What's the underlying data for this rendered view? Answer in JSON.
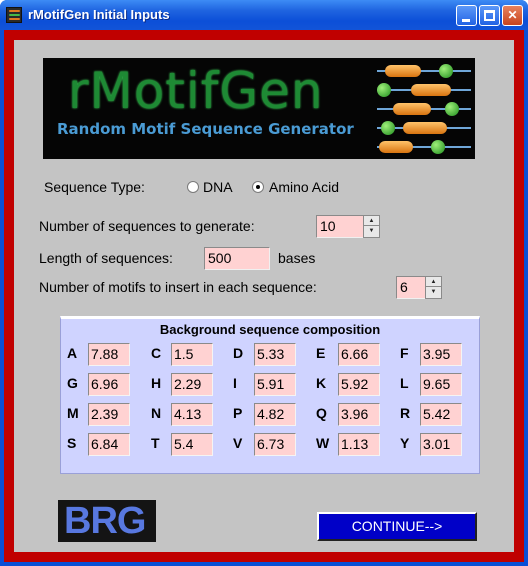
{
  "window": {
    "title": "rMotifGen Initial Inputs"
  },
  "banner": {
    "title": "rMotifGen",
    "subtitle": "Random Motif Sequence Generator"
  },
  "sequence_type": {
    "label": "Sequence Type:",
    "options": [
      "DNA",
      "Amino Acid"
    ],
    "selected": "Amino Acid"
  },
  "num_sequences": {
    "label": "Number of sequences to generate:",
    "value": "10"
  },
  "length": {
    "label": "Length of sequences:",
    "value": "500",
    "unit": "bases"
  },
  "num_motifs": {
    "label": "Number of motifs to insert in each sequence:",
    "value": "6"
  },
  "composition": {
    "title": "Background sequence composition",
    "rows": [
      [
        {
          "letter": "A",
          "value": "7.88"
        },
        {
          "letter": "C",
          "value": "1.5"
        },
        {
          "letter": "D",
          "value": "5.33"
        },
        {
          "letter": "E",
          "value": "6.66"
        },
        {
          "letter": "F",
          "value": "3.95"
        }
      ],
      [
        {
          "letter": "G",
          "value": "6.96"
        },
        {
          "letter": "H",
          "value": "2.29"
        },
        {
          "letter": "I",
          "value": "5.91"
        },
        {
          "letter": "K",
          "value": "5.92"
        },
        {
          "letter": "L",
          "value": "9.65"
        }
      ],
      [
        {
          "letter": "M",
          "value": "2.39"
        },
        {
          "letter": "N",
          "value": "4.13"
        },
        {
          "letter": "P",
          "value": "4.82"
        },
        {
          "letter": "Q",
          "value": "3.96"
        },
        {
          "letter": "R",
          "value": "5.42"
        }
      ],
      [
        {
          "letter": "S",
          "value": "6.84"
        },
        {
          "letter": "T",
          "value": "5.4"
        },
        {
          "letter": "V",
          "value": "6.73"
        },
        {
          "letter": "W",
          "value": "1.13"
        },
        {
          "letter": "Y",
          "value": "3.01"
        }
      ]
    ]
  },
  "logo": {
    "text": "BRG"
  },
  "continue_label": "CONTINUE-->",
  "colors": {
    "frame": "#c00000",
    "panel": "#c4c4c4",
    "field": "#ffd2d2",
    "composition_bg": "#cfd3ff",
    "button": "#0000c8"
  }
}
